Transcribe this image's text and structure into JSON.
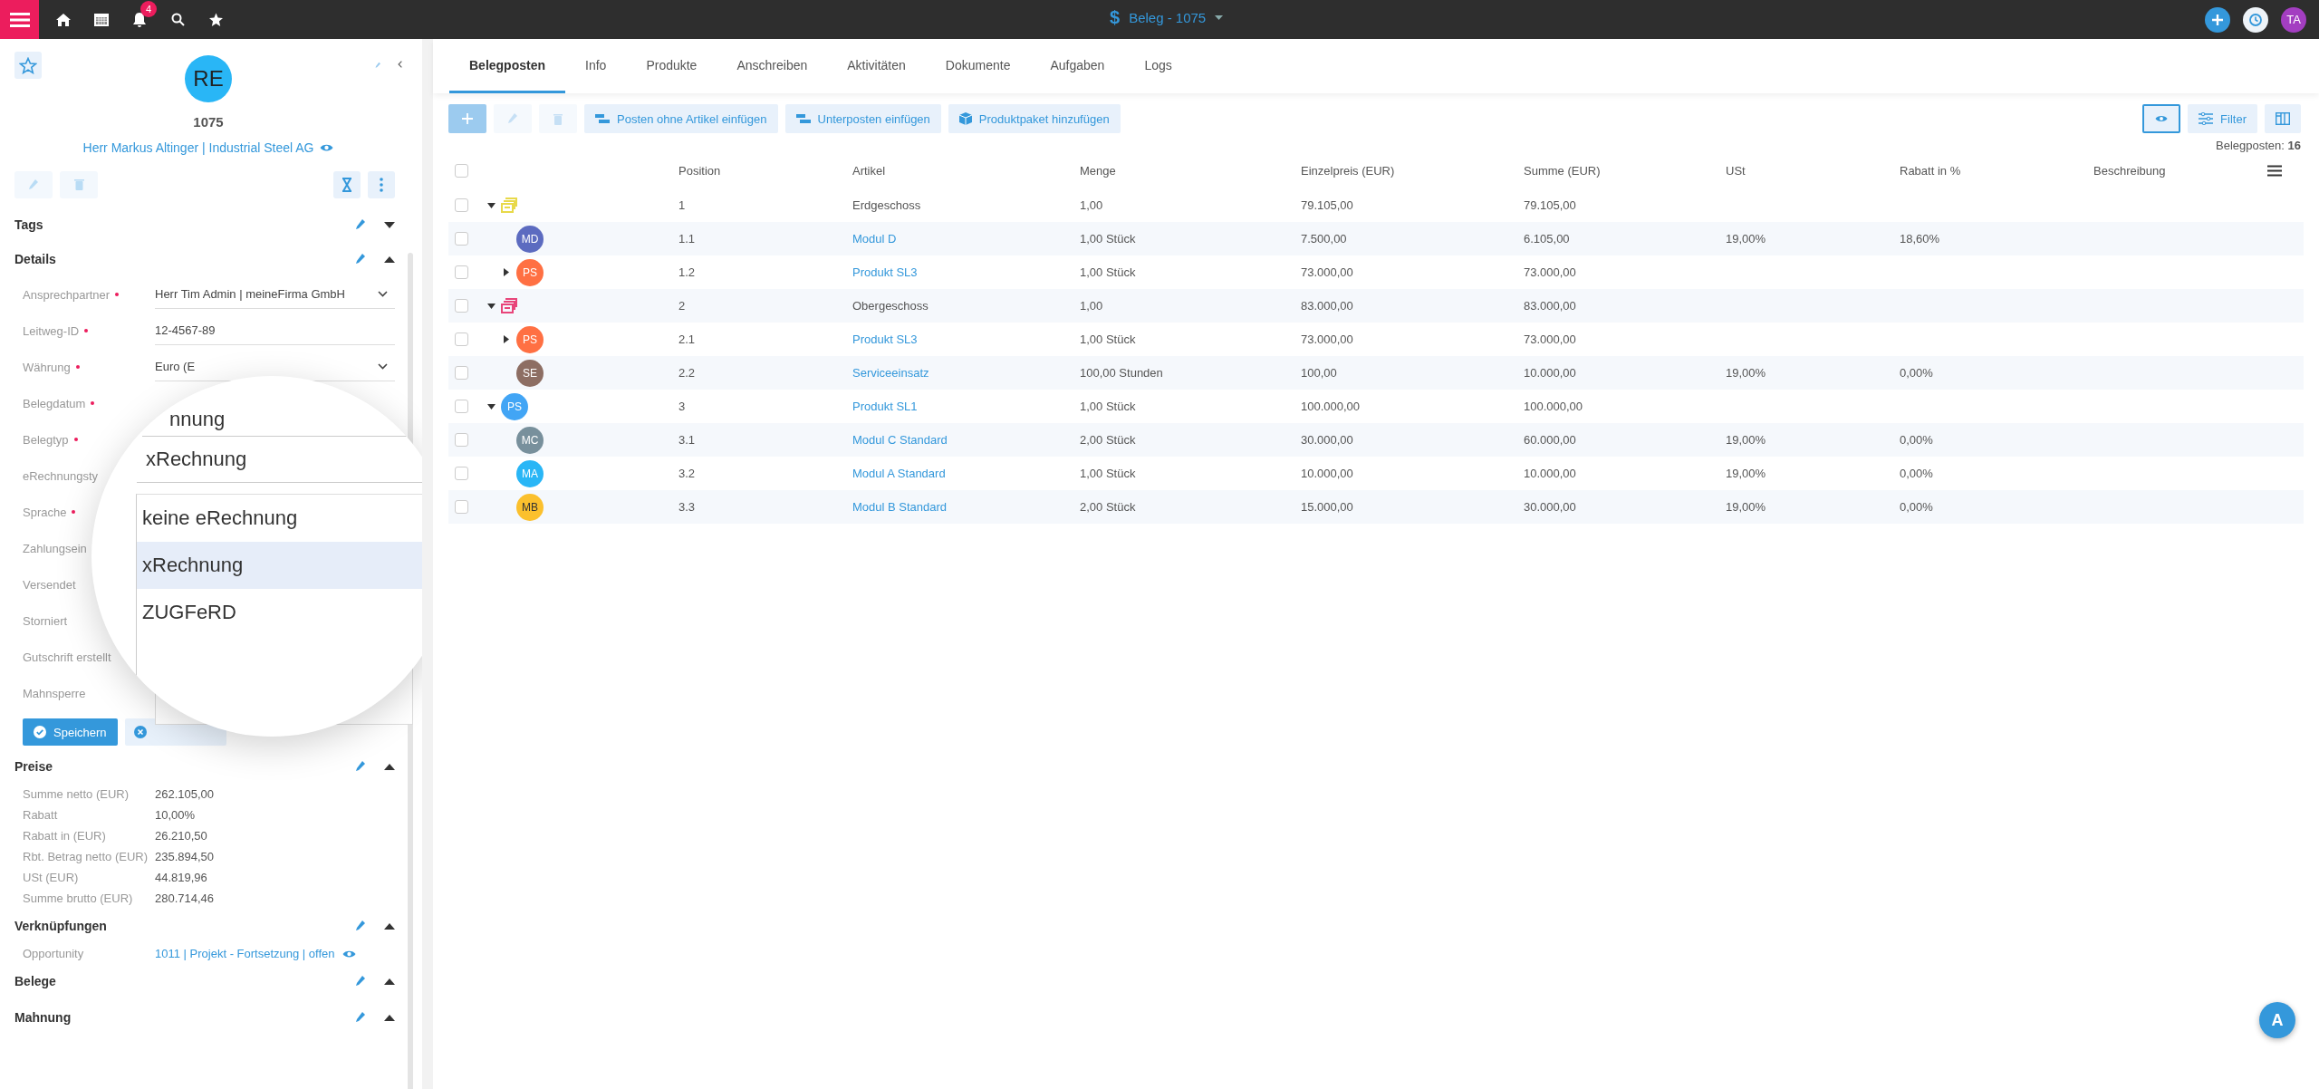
{
  "topbar": {
    "notification_count": "4",
    "currency_symbol": "$",
    "title": "Beleg - 1075",
    "user_initials": "TA"
  },
  "sidebar": {
    "avatar": "RE",
    "number": "1075",
    "contact": "Herr Markus Altinger | Industrial Steel AG",
    "sections": [
      {
        "title": "Tags",
        "expanded": false
      },
      {
        "title": "Details",
        "expanded": true,
        "fields": [
          {
            "label": "Ansprechpartner",
            "required": true,
            "kind": "select",
            "value": "Herr Tim Admin | meineFirma GmbH"
          },
          {
            "label": "Leitweg-ID",
            "required": true,
            "kind": "text",
            "value": "12-4567-89"
          },
          {
            "label": "Währung",
            "required": true,
            "kind": "select",
            "value": "Euro (E"
          },
          {
            "label": "Belegdatum",
            "required": true,
            "kind": "label"
          },
          {
            "label": "Belegtyp",
            "required": true,
            "kind": "label"
          },
          {
            "label": "eRechnungsty",
            "required": false,
            "kind": "label"
          },
          {
            "label": "Sprache",
            "required": true,
            "kind": "label"
          },
          {
            "label": "Zahlungsein",
            "required": false,
            "kind": "label"
          },
          {
            "label": "Versendet",
            "required": false,
            "kind": "label"
          },
          {
            "label": "Storniert",
            "required": false,
            "kind": "label"
          },
          {
            "label": "Gutschrift erstellt",
            "required": false,
            "kind": "label"
          },
          {
            "label": "Mahnsperre",
            "required": false,
            "kind": "label"
          }
        ],
        "save_label": "Speichern"
      },
      {
        "title": "Preise",
        "expanded": true,
        "fields": [
          {
            "label": "Summe netto (EUR)",
            "kind": "plain",
            "value": "262.105,00"
          },
          {
            "label": "Rabatt",
            "kind": "plain",
            "value": "10,00%"
          },
          {
            "label": "Rabatt in (EUR)",
            "kind": "plain",
            "value": "26.210,50"
          },
          {
            "label": "Rbt. Betrag netto (EUR)",
            "kind": "plain",
            "value": "235.894,50"
          },
          {
            "label": "USt (EUR)",
            "kind": "plain",
            "value": "44.819,96"
          },
          {
            "label": "Summe brutto (EUR)",
            "kind": "plain",
            "value": "280.714,46"
          }
        ]
      },
      {
        "title": "Verknüpfungen",
        "expanded": true,
        "fields": [
          {
            "label": "Opportunity",
            "kind": "link",
            "value": "1011 | Projekt - Fortsetzung | offen"
          }
        ]
      },
      {
        "title": "Belege",
        "expanded": true
      },
      {
        "title": "Mahnung",
        "expanded": true
      }
    ],
    "magnifier": {
      "partial_text": "nnung",
      "value": "xRechnung",
      "options": [
        {
          "label": "keine eRechnung",
          "selected": false
        },
        {
          "label": "xRechnung",
          "selected": true
        },
        {
          "label": "ZUGFeRD",
          "selected": false
        }
      ]
    }
  },
  "tabs": [
    {
      "label": "Belegposten",
      "selected": true
    },
    {
      "label": "Info",
      "selected": false
    },
    {
      "label": "Produkte",
      "selected": false
    },
    {
      "label": "Anschreiben",
      "selected": false
    },
    {
      "label": "Aktivitäten",
      "selected": false
    },
    {
      "label": "Dokumente",
      "selected": false
    },
    {
      "label": "Aufgaben",
      "selected": false
    },
    {
      "label": "Logs",
      "selected": false
    }
  ],
  "toolbar": {
    "actions": [
      {
        "label": "Posten ohne Artikel einfügen",
        "kind": "rows"
      },
      {
        "label": "Unterposten einfügen",
        "kind": "rows"
      },
      {
        "label": "Produktpaket hinzufügen",
        "kind": "package"
      }
    ],
    "view_selected": true,
    "filter_label": "Filter",
    "count": "Belegposten: **16**"
  },
  "table": {
    "header_checked": false,
    "columns": [
      "Position",
      "Artikel",
      "Menge",
      "Einzelpreis (EUR)",
      "Summe (EUR)",
      "USt",
      "Rabatt in %",
      "Beschreibung"
    ],
    "rows": [
      {
        "kind": "group",
        "expanded": true,
        "color": "#e8d94a",
        "checked": false,
        "cells": [
          "1",
          "Erdgeschoss",
          "1,00",
          "79.105,00",
          "79.105,00",
          "",
          "",
          ""
        ],
        "children": [
          {
            "kind": "product",
            "avatar": "MD",
            "color": "#5c6bc0",
            "checked": false,
            "cells": [
              "1.1",
              "Modul D",
              "1,00 Stück",
              "7.500,00",
              "6.105,00",
              "19,00%",
              "18,60%",
              ""
            ]
          },
          {
            "kind": "product",
            "expanded": false,
            "avatar": "PS",
            "color": "#ff7043",
            "checked": false,
            "cells": [
              "1.2",
              "Produkt SL3",
              "1,00 Stück",
              "73.000,00",
              "73.000,00",
              "",
              "",
              ""
            ]
          }
        ]
      },
      {
        "kind": "group",
        "expanded": true,
        "color": "#e8457a",
        "checked": false,
        "cells": [
          "2",
          "Obergeschoss",
          "1,00",
          "83.000,00",
          "83.000,00",
          "",
          "",
          ""
        ],
        "children": [
          {
            "kind": "product",
            "expanded": false,
            "avatar": "PS",
            "color": "#ff7043",
            "checked": false,
            "cells": [
              "2.1",
              "Produkt SL3",
              "1,00 Stück",
              "73.000,00",
              "73.000,00",
              "",
              "",
              ""
            ]
          },
          {
            "kind": "product",
            "avatar": "SE",
            "color": "#8d6e63",
            "checked": false,
            "cells": [
              "2.2",
              "Serviceeinsatz",
              "100,00 Stunden",
              "100,00",
              "10.000,00",
              "19,00%",
              "0,00%",
              ""
            ]
          }
        ]
      },
      {
        "kind": "product",
        "expanded": true,
        "avatar": "PS",
        "color": "#42a5f5",
        "checked": false,
        "cells": [
          "3",
          "Produkt SL1",
          "1,00 Stück",
          "100.000,00",
          "100.000,00",
          "",
          "",
          ""
        ],
        "children": [
          {
            "kind": "product",
            "avatar": "MC",
            "color": "#78909c",
            "checked": false,
            "cells": [
              "3.1",
              "Modul C Standard",
              "2,00 Stück",
              "30.000,00",
              "60.000,00",
              "19,00%",
              "0,00%",
              ""
            ]
          },
          {
            "kind": "product",
            "avatar": "MA",
            "color": "#29b6f6",
            "checked": false,
            "cells": [
              "3.2",
              "Modul A Standard",
              "1,00 Stück",
              "10.000,00",
              "10.000,00",
              "19,00%",
              "0,00%",
              ""
            ]
          },
          {
            "kind": "product",
            "avatar": "MB",
            "color": "#fbc02d",
            "checked": false,
            "cells": [
              "3.3",
              "Modul B Standard",
              "2,00 Stück",
              "15.000,00",
              "30.000,00",
              "19,00%",
              "0,00%",
              ""
            ]
          }
        ]
      }
    ]
  },
  "assistant_label": "A"
}
